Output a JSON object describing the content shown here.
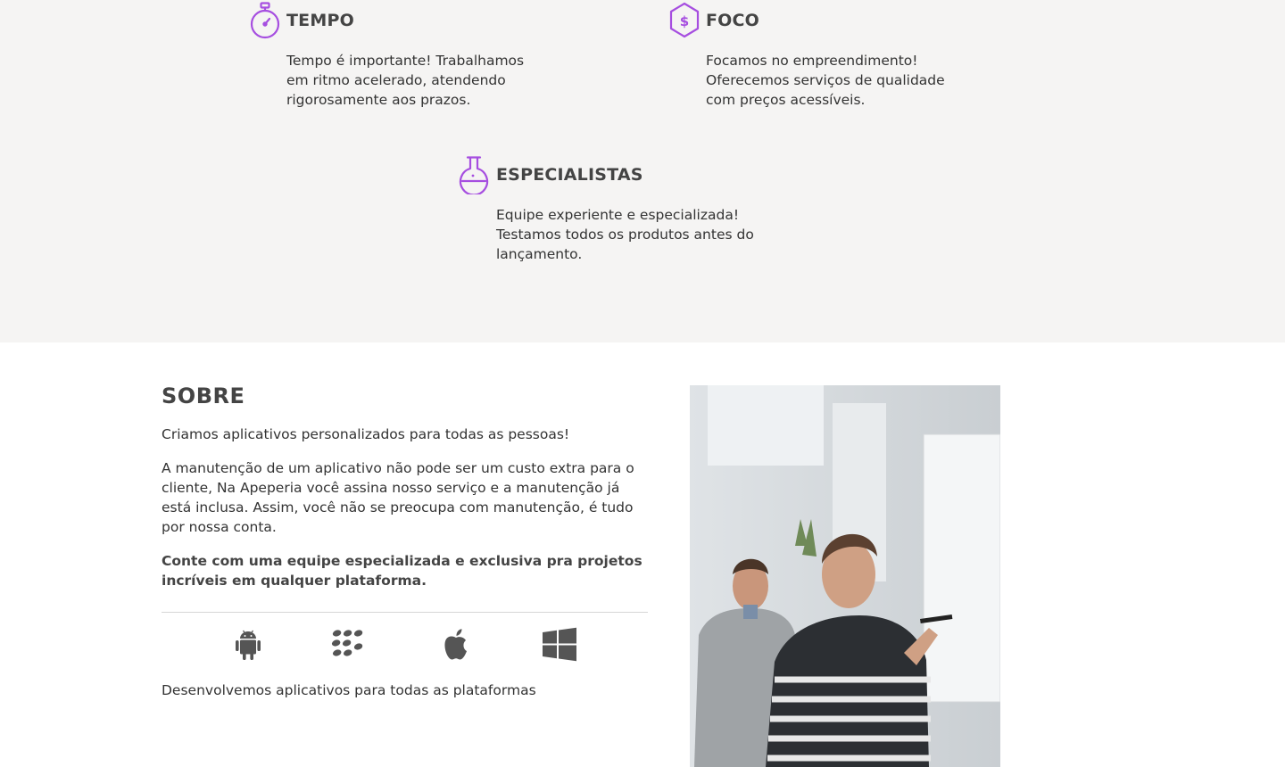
{
  "features": {
    "tempo": {
      "icon": "stopwatch-icon",
      "title": "TEMPO",
      "text": "Tempo é importante! Trabalhamos em ritmo acelerado, atendendo rigorosamente aos prazos."
    },
    "foco": {
      "icon": "dollar-hexagon-icon",
      "title": "FOCO",
      "text": "Focamos no empreendimento! Oferecemos serviços de qualidade com preços acessíveis."
    },
    "especialistas": {
      "icon": "flask-icon",
      "title": "ESPECIALISTAS",
      "text": "Equipe experiente e especializada! Testamos todos os produtos antes do lançamento."
    }
  },
  "about": {
    "title": "SOBRE",
    "paragraph1": "Criamos aplicativos personalizados para todas as pessoas!",
    "paragraph2": "A manutenção de um aplicativo não pode ser um custo extra para o cliente, Na Apeperia você assina nosso serviço e a manutenção já está inclusa. Assim, você não se preocupa com manutenção, é tudo por nossa conta.",
    "highlight": "Conte com uma equipe especializada e exclusiva pra projetos incríveis em qualquer plataforma.",
    "platforms": [
      "android-icon",
      "blackberry-icon",
      "apple-icon",
      "windows-icon"
    ],
    "caption": "Desenvolvemos aplicativos para todas as plataformas"
  },
  "photo": {
    "subject": "two-men-at-whiteboard-photo"
  },
  "colors": {
    "accent": "#a64ee0",
    "section_bg": "#f5f4f3",
    "heading": "#444444",
    "text": "#333333",
    "icon_gray": "#555555"
  }
}
